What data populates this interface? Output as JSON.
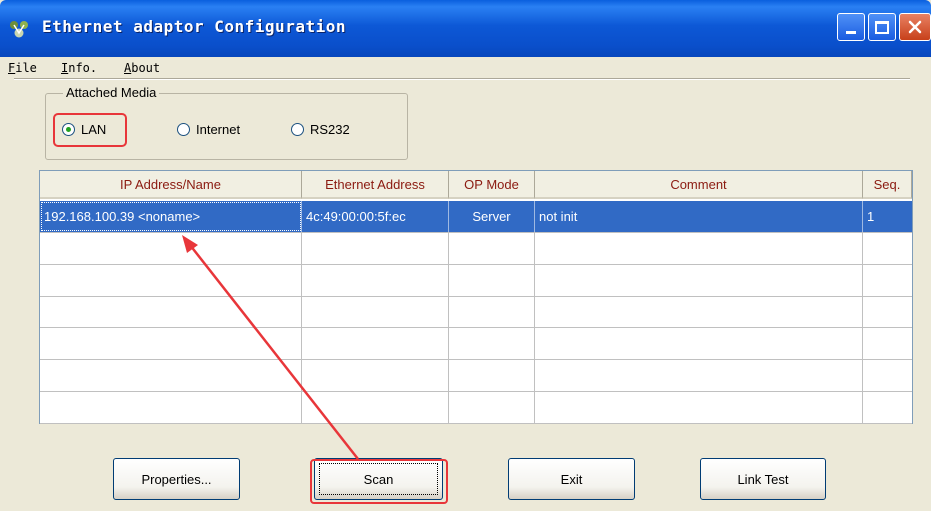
{
  "window": {
    "title": "Ethernet adaptor Configuration",
    "app_icon": "network-icon",
    "controls": [
      "minimize-icon",
      "maximize-icon",
      "close-icon"
    ]
  },
  "menu": {
    "items": [
      "File",
      "Info.",
      "About"
    ]
  },
  "attached_media": {
    "label": "Attached Media",
    "options": [
      "LAN",
      "Internet",
      "RS232"
    ],
    "selected": "LAN"
  },
  "table": {
    "columns": [
      "IP Address/Name",
      "Ethernet Address",
      "OP Mode",
      "Comment",
      "Seq."
    ],
    "rows": [
      [
        "192.168.100.39 <noname>",
        "4c:49:00:00:5f:ec",
        "Server",
        "not init",
        "1"
      ]
    ],
    "empty_rows": 6
  },
  "buttons": {
    "properties": "Properties...",
    "scan": "Scan",
    "exit": "Exit",
    "link_test": "Link Test"
  },
  "annotations": {
    "highlight_color": "#e8363a",
    "selection_color": "#316ac5"
  }
}
